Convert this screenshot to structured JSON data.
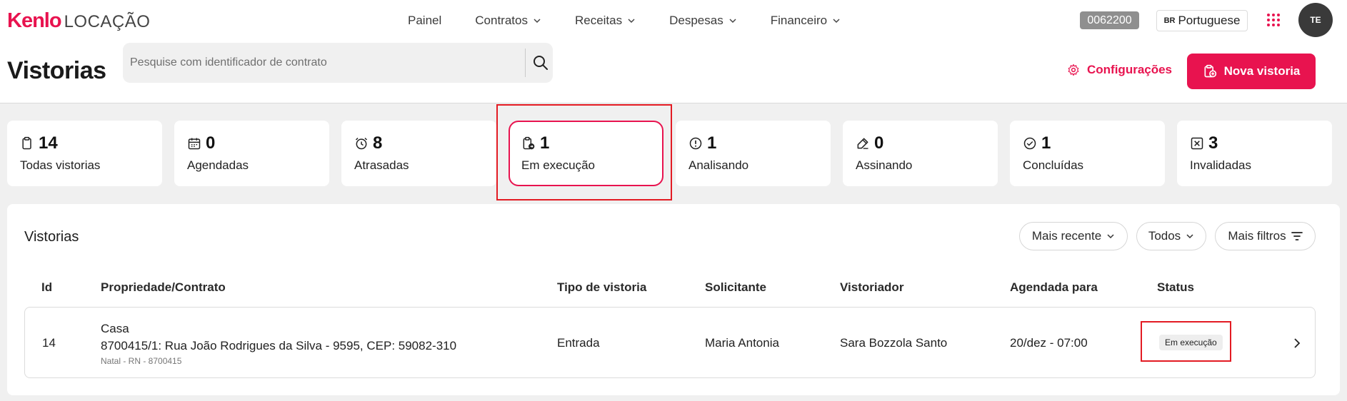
{
  "app": {
    "brand": "Kenlo",
    "brand_suffix": "LOCAÇÃO"
  },
  "nav": [
    {
      "label": "Painel",
      "has_dropdown": false
    },
    {
      "label": "Contratos",
      "has_dropdown": true
    },
    {
      "label": "Receitas",
      "has_dropdown": true
    },
    {
      "label": "Despesas",
      "has_dropdown": true
    },
    {
      "label": "Financeiro",
      "has_dropdown": true
    }
  ],
  "header": {
    "account_code": "0062200",
    "language": {
      "country_code": "BR",
      "label": "Portuguese"
    },
    "apps_icon": "grid-dots-icon",
    "avatar_initials": "TE"
  },
  "page": {
    "title": "Vistorias",
    "search": {
      "placeholder": "Pesquise com identificador de contrato",
      "value": ""
    },
    "config_label": "Configurações",
    "new_button_label": "Nova vistoria"
  },
  "status_cards": [
    {
      "count": "14",
      "label": "Todas vistorias",
      "icon": "clipboard-icon",
      "active": false
    },
    {
      "count": "0",
      "label": "Agendadas",
      "icon": "calendar-icon",
      "active": false
    },
    {
      "count": "8",
      "label": "Atrasadas",
      "icon": "alarm-clock-icon",
      "active": false
    },
    {
      "count": "1",
      "label": "Em execução",
      "icon": "clipboard-progress-icon",
      "active": true
    },
    {
      "count": "1",
      "label": "Analisando",
      "icon": "alert-circle-icon",
      "active": false
    },
    {
      "count": "0",
      "label": "Assinando",
      "icon": "signature-pen-icon",
      "active": false
    },
    {
      "count": "1",
      "label": "Concluídas",
      "icon": "check-circle-icon",
      "active": false
    },
    {
      "count": "3",
      "label": "Invalidadas",
      "icon": "x-square-icon",
      "active": false
    }
  ],
  "list": {
    "title": "Vistorias",
    "filters": {
      "sort_label": "Mais recente",
      "type_label": "Todos",
      "more_label": "Mais filtros"
    },
    "columns": [
      "Id",
      "Propriedade/Contrato",
      "Tipo de vistoria",
      "Solicitante",
      "Vistoriador",
      "Agendada para",
      "Status"
    ],
    "rows": [
      {
        "id": "14",
        "property_title": "Casa",
        "property_address": "8700415/1: Rua João Rodrigues da Silva - 9595, CEP: 59082-310",
        "property_city": "Natal - RN - 8700415",
        "type": "Entrada",
        "requester": "Maria Antonia",
        "inspector": "Sara Bozzola Santo",
        "scheduled": "20/dez - 07:00",
        "status": "Em execução"
      }
    ]
  },
  "colors": {
    "accent": "#e8134f",
    "highlight_box": "#e31b23",
    "background": "#f0f0f0"
  }
}
